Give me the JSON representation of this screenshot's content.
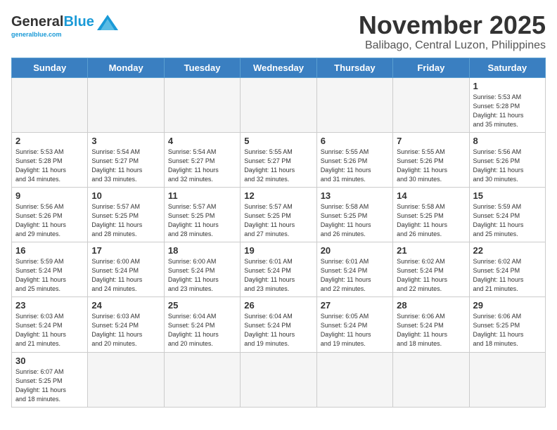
{
  "header": {
    "logo_line1": "General",
    "logo_line2": "Blue",
    "month_title": "November 2025",
    "location": "Balibago, Central Luzon, Philippines"
  },
  "days_of_week": [
    "Sunday",
    "Monday",
    "Tuesday",
    "Wednesday",
    "Thursday",
    "Friday",
    "Saturday"
  ],
  "weeks": [
    [
      {
        "day": "",
        "info": ""
      },
      {
        "day": "",
        "info": ""
      },
      {
        "day": "",
        "info": ""
      },
      {
        "day": "",
        "info": ""
      },
      {
        "day": "",
        "info": ""
      },
      {
        "day": "",
        "info": ""
      },
      {
        "day": "1",
        "info": "Sunrise: 5:53 AM\nSunset: 5:28 PM\nDaylight: 11 hours\nand 35 minutes."
      }
    ],
    [
      {
        "day": "2",
        "info": "Sunrise: 5:53 AM\nSunset: 5:28 PM\nDaylight: 11 hours\nand 34 minutes."
      },
      {
        "day": "3",
        "info": "Sunrise: 5:54 AM\nSunset: 5:27 PM\nDaylight: 11 hours\nand 33 minutes."
      },
      {
        "day": "4",
        "info": "Sunrise: 5:54 AM\nSunset: 5:27 PM\nDaylight: 11 hours\nand 32 minutes."
      },
      {
        "day": "5",
        "info": "Sunrise: 5:55 AM\nSunset: 5:27 PM\nDaylight: 11 hours\nand 32 minutes."
      },
      {
        "day": "6",
        "info": "Sunrise: 5:55 AM\nSunset: 5:26 PM\nDaylight: 11 hours\nand 31 minutes."
      },
      {
        "day": "7",
        "info": "Sunrise: 5:55 AM\nSunset: 5:26 PM\nDaylight: 11 hours\nand 30 minutes."
      },
      {
        "day": "8",
        "info": "Sunrise: 5:56 AM\nSunset: 5:26 PM\nDaylight: 11 hours\nand 30 minutes."
      }
    ],
    [
      {
        "day": "9",
        "info": "Sunrise: 5:56 AM\nSunset: 5:26 PM\nDaylight: 11 hours\nand 29 minutes."
      },
      {
        "day": "10",
        "info": "Sunrise: 5:57 AM\nSunset: 5:25 PM\nDaylight: 11 hours\nand 28 minutes."
      },
      {
        "day": "11",
        "info": "Sunrise: 5:57 AM\nSunset: 5:25 PM\nDaylight: 11 hours\nand 28 minutes."
      },
      {
        "day": "12",
        "info": "Sunrise: 5:57 AM\nSunset: 5:25 PM\nDaylight: 11 hours\nand 27 minutes."
      },
      {
        "day": "13",
        "info": "Sunrise: 5:58 AM\nSunset: 5:25 PM\nDaylight: 11 hours\nand 26 minutes."
      },
      {
        "day": "14",
        "info": "Sunrise: 5:58 AM\nSunset: 5:25 PM\nDaylight: 11 hours\nand 26 minutes."
      },
      {
        "day": "15",
        "info": "Sunrise: 5:59 AM\nSunset: 5:24 PM\nDaylight: 11 hours\nand 25 minutes."
      }
    ],
    [
      {
        "day": "16",
        "info": "Sunrise: 5:59 AM\nSunset: 5:24 PM\nDaylight: 11 hours\nand 25 minutes."
      },
      {
        "day": "17",
        "info": "Sunrise: 6:00 AM\nSunset: 5:24 PM\nDaylight: 11 hours\nand 24 minutes."
      },
      {
        "day": "18",
        "info": "Sunrise: 6:00 AM\nSunset: 5:24 PM\nDaylight: 11 hours\nand 23 minutes."
      },
      {
        "day": "19",
        "info": "Sunrise: 6:01 AM\nSunset: 5:24 PM\nDaylight: 11 hours\nand 23 minutes."
      },
      {
        "day": "20",
        "info": "Sunrise: 6:01 AM\nSunset: 5:24 PM\nDaylight: 11 hours\nand 22 minutes."
      },
      {
        "day": "21",
        "info": "Sunrise: 6:02 AM\nSunset: 5:24 PM\nDaylight: 11 hours\nand 22 minutes."
      },
      {
        "day": "22",
        "info": "Sunrise: 6:02 AM\nSunset: 5:24 PM\nDaylight: 11 hours\nand 21 minutes."
      }
    ],
    [
      {
        "day": "23",
        "info": "Sunrise: 6:03 AM\nSunset: 5:24 PM\nDaylight: 11 hours\nand 21 minutes."
      },
      {
        "day": "24",
        "info": "Sunrise: 6:03 AM\nSunset: 5:24 PM\nDaylight: 11 hours\nand 20 minutes."
      },
      {
        "day": "25",
        "info": "Sunrise: 6:04 AM\nSunset: 5:24 PM\nDaylight: 11 hours\nand 20 minutes."
      },
      {
        "day": "26",
        "info": "Sunrise: 6:04 AM\nSunset: 5:24 PM\nDaylight: 11 hours\nand 19 minutes."
      },
      {
        "day": "27",
        "info": "Sunrise: 6:05 AM\nSunset: 5:24 PM\nDaylight: 11 hours\nand 19 minutes."
      },
      {
        "day": "28",
        "info": "Sunrise: 6:06 AM\nSunset: 5:24 PM\nDaylight: 11 hours\nand 18 minutes."
      },
      {
        "day": "29",
        "info": "Sunrise: 6:06 AM\nSunset: 5:25 PM\nDaylight: 11 hours\nand 18 minutes."
      }
    ],
    [
      {
        "day": "30",
        "info": "Sunrise: 6:07 AM\nSunset: 5:25 PM\nDaylight: 11 hours\nand 18 minutes."
      },
      {
        "day": "",
        "info": ""
      },
      {
        "day": "",
        "info": ""
      },
      {
        "day": "",
        "info": ""
      },
      {
        "day": "",
        "info": ""
      },
      {
        "day": "",
        "info": ""
      },
      {
        "day": "",
        "info": ""
      }
    ]
  ]
}
